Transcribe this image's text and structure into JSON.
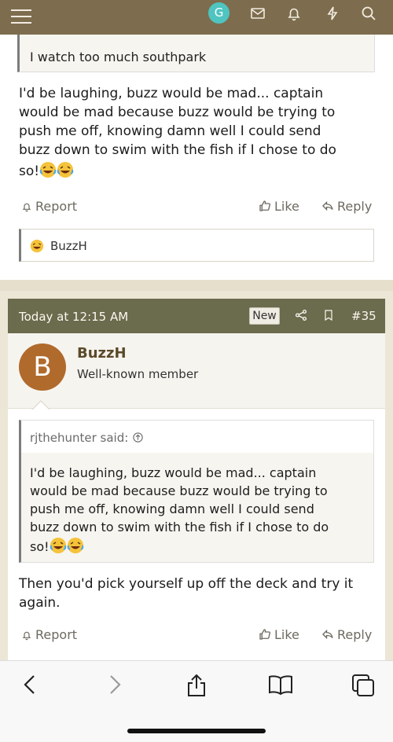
{
  "topbar": {
    "avatar_letter": "G",
    "icons": [
      "menu-icon",
      "avatar",
      "mail-icon",
      "bell-icon",
      "lightning-icon",
      "search-icon"
    ],
    "color": "#7d6d4e"
  },
  "prev_post": {
    "quote_tail": "I watch too much southpark",
    "body_line1": "I'd be laughing, buzz would be mad... captain",
    "body_line2": "would be mad because buzz would be trying to",
    "body_line3": "push me off, knowing damn well I could send",
    "body_line4": "buzz down to swim with the fish if I chose to do",
    "body_line5": "so!",
    "report": "Report",
    "like": "Like",
    "reply": "Reply",
    "reaction_user": "BuzzH"
  },
  "post": {
    "time": "Today at 12:15 AM",
    "badge": "New",
    "number": "#35",
    "user_initial": "B",
    "username": "BuzzH",
    "user_title": "Well-known member",
    "quote_author": "rjthehunter said:",
    "quote_line1": "I'd be laughing, buzz would be mad... captain",
    "quote_line2": "would be mad because buzz would be trying to",
    "quote_line3": "push me off, knowing damn well I could send",
    "quote_line4": "buzz down to swim with the fish if I chose to do",
    "quote_line5": "so!",
    "body_line1": "Then you'd pick yourself up off the deck and try it",
    "body_line2": "again.",
    "report": "Report",
    "like": "Like",
    "reply": "Reply",
    "header_color": "#6b6b4d"
  },
  "browser": {
    "icons": [
      "back-icon",
      "forward-icon",
      "share-icon",
      "bookmarks-icon",
      "tabs-icon"
    ]
  }
}
